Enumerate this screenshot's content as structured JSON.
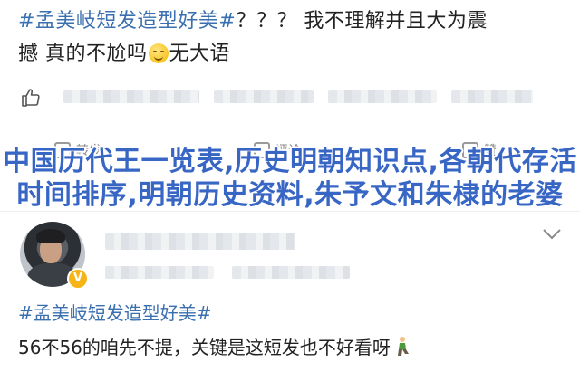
{
  "post1": {
    "hashtag": "#孟美岐短发造型好美#",
    "text_line1": "？？？ 我不理解并且大为震",
    "text_line2": "撼 真的不尬吗",
    "text_tail": "无大语",
    "emoji": "grinning-sweat-emoji"
  },
  "action_bar": {
    "forward_label": "转发",
    "comment_label": "评论",
    "like_label": "赞"
  },
  "overlay": {
    "title": "中国历代王一览表,历史明朝知识点,各朝代存活时间排序,明朝历史资料,朱予文和朱棣的老婆"
  },
  "post2": {
    "verified_badge": "V",
    "hashtag": "#孟美岐短发造型好美#",
    "text": "56不56的咱先不提，关键是这短发也不好看呀",
    "emoji": "kneeling-person-emoji"
  },
  "colors": {
    "hashtag": "#3a6fb0",
    "overlay_title": "#3866c4",
    "badge": "#f6b417"
  }
}
